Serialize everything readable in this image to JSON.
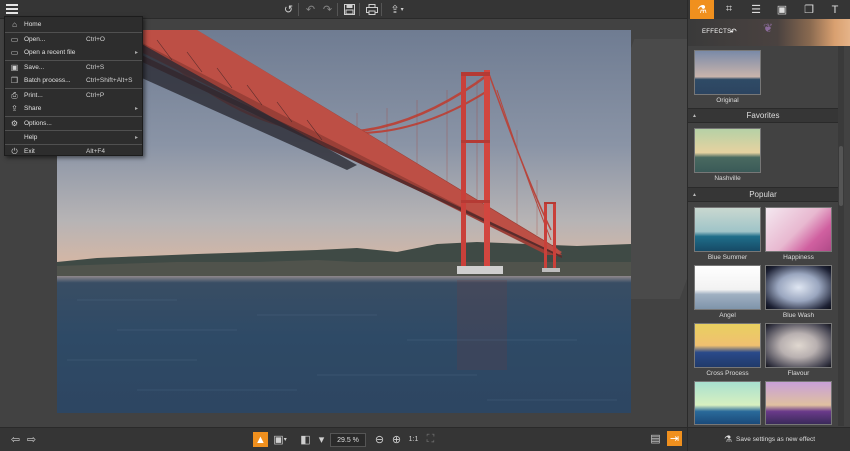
{
  "toolbar": {
    "undo_icon": "undo-icon",
    "redo_icon": "redo-icon",
    "save_icon": "save-icon",
    "print_icon": "print-icon",
    "share_icon": "share-icon"
  },
  "menu": {
    "items": [
      {
        "label": "Home",
        "shortcut": "",
        "icon": "home-icon",
        "submenu": false
      },
      {
        "label": "Open...",
        "shortcut": "Ctrl+O",
        "icon": "folder-open-icon",
        "submenu": false
      },
      {
        "label": "Open a recent file",
        "shortcut": "",
        "icon": "folder-icon",
        "submenu": true
      },
      {
        "label": "Save...",
        "shortcut": "Ctrl+S",
        "icon": "save-icon",
        "submenu": false
      },
      {
        "label": "Batch process...",
        "shortcut": "Ctrl+Shift+Alt+S",
        "icon": "batch-icon",
        "submenu": false
      },
      {
        "label": "Print...",
        "shortcut": "Ctrl+P",
        "icon": "print-icon",
        "submenu": false
      },
      {
        "label": "Share",
        "shortcut": "",
        "icon": "share-icon",
        "submenu": true
      },
      {
        "label": "Options...",
        "shortcut": "",
        "icon": "gear-icon",
        "submenu": false
      },
      {
        "label": "Help",
        "shortcut": "",
        "icon": "help-icon",
        "submenu": true
      },
      {
        "label": "Exit",
        "shortcut": "Alt+F4",
        "icon": "power-icon",
        "submenu": false
      }
    ]
  },
  "bottombar": {
    "zoom": "29.5 %"
  },
  "panel": {
    "tabs": [
      "effects-icon",
      "crop-icon",
      "adjust-icon",
      "frame-icon",
      "layers-icon",
      "text-icon"
    ],
    "effects_label": "EFFECTS:",
    "original_label": "Original",
    "favorites_title": "Favorites",
    "favorites": [
      {
        "label": "Nashville"
      }
    ],
    "popular_title": "Popular",
    "popular": [
      {
        "label": "Blue Summer"
      },
      {
        "label": "Happiness"
      },
      {
        "label": "Angel"
      },
      {
        "label": "Blue Wash"
      },
      {
        "label": "Cross Process"
      },
      {
        "label": "Flavour"
      },
      {
        "label": ""
      },
      {
        "label": ""
      }
    ],
    "save_effect_label": "Save settings as new effect"
  },
  "colors": {
    "accent": "#f0901e",
    "bridge": "#c9403a",
    "background": "#424242"
  }
}
